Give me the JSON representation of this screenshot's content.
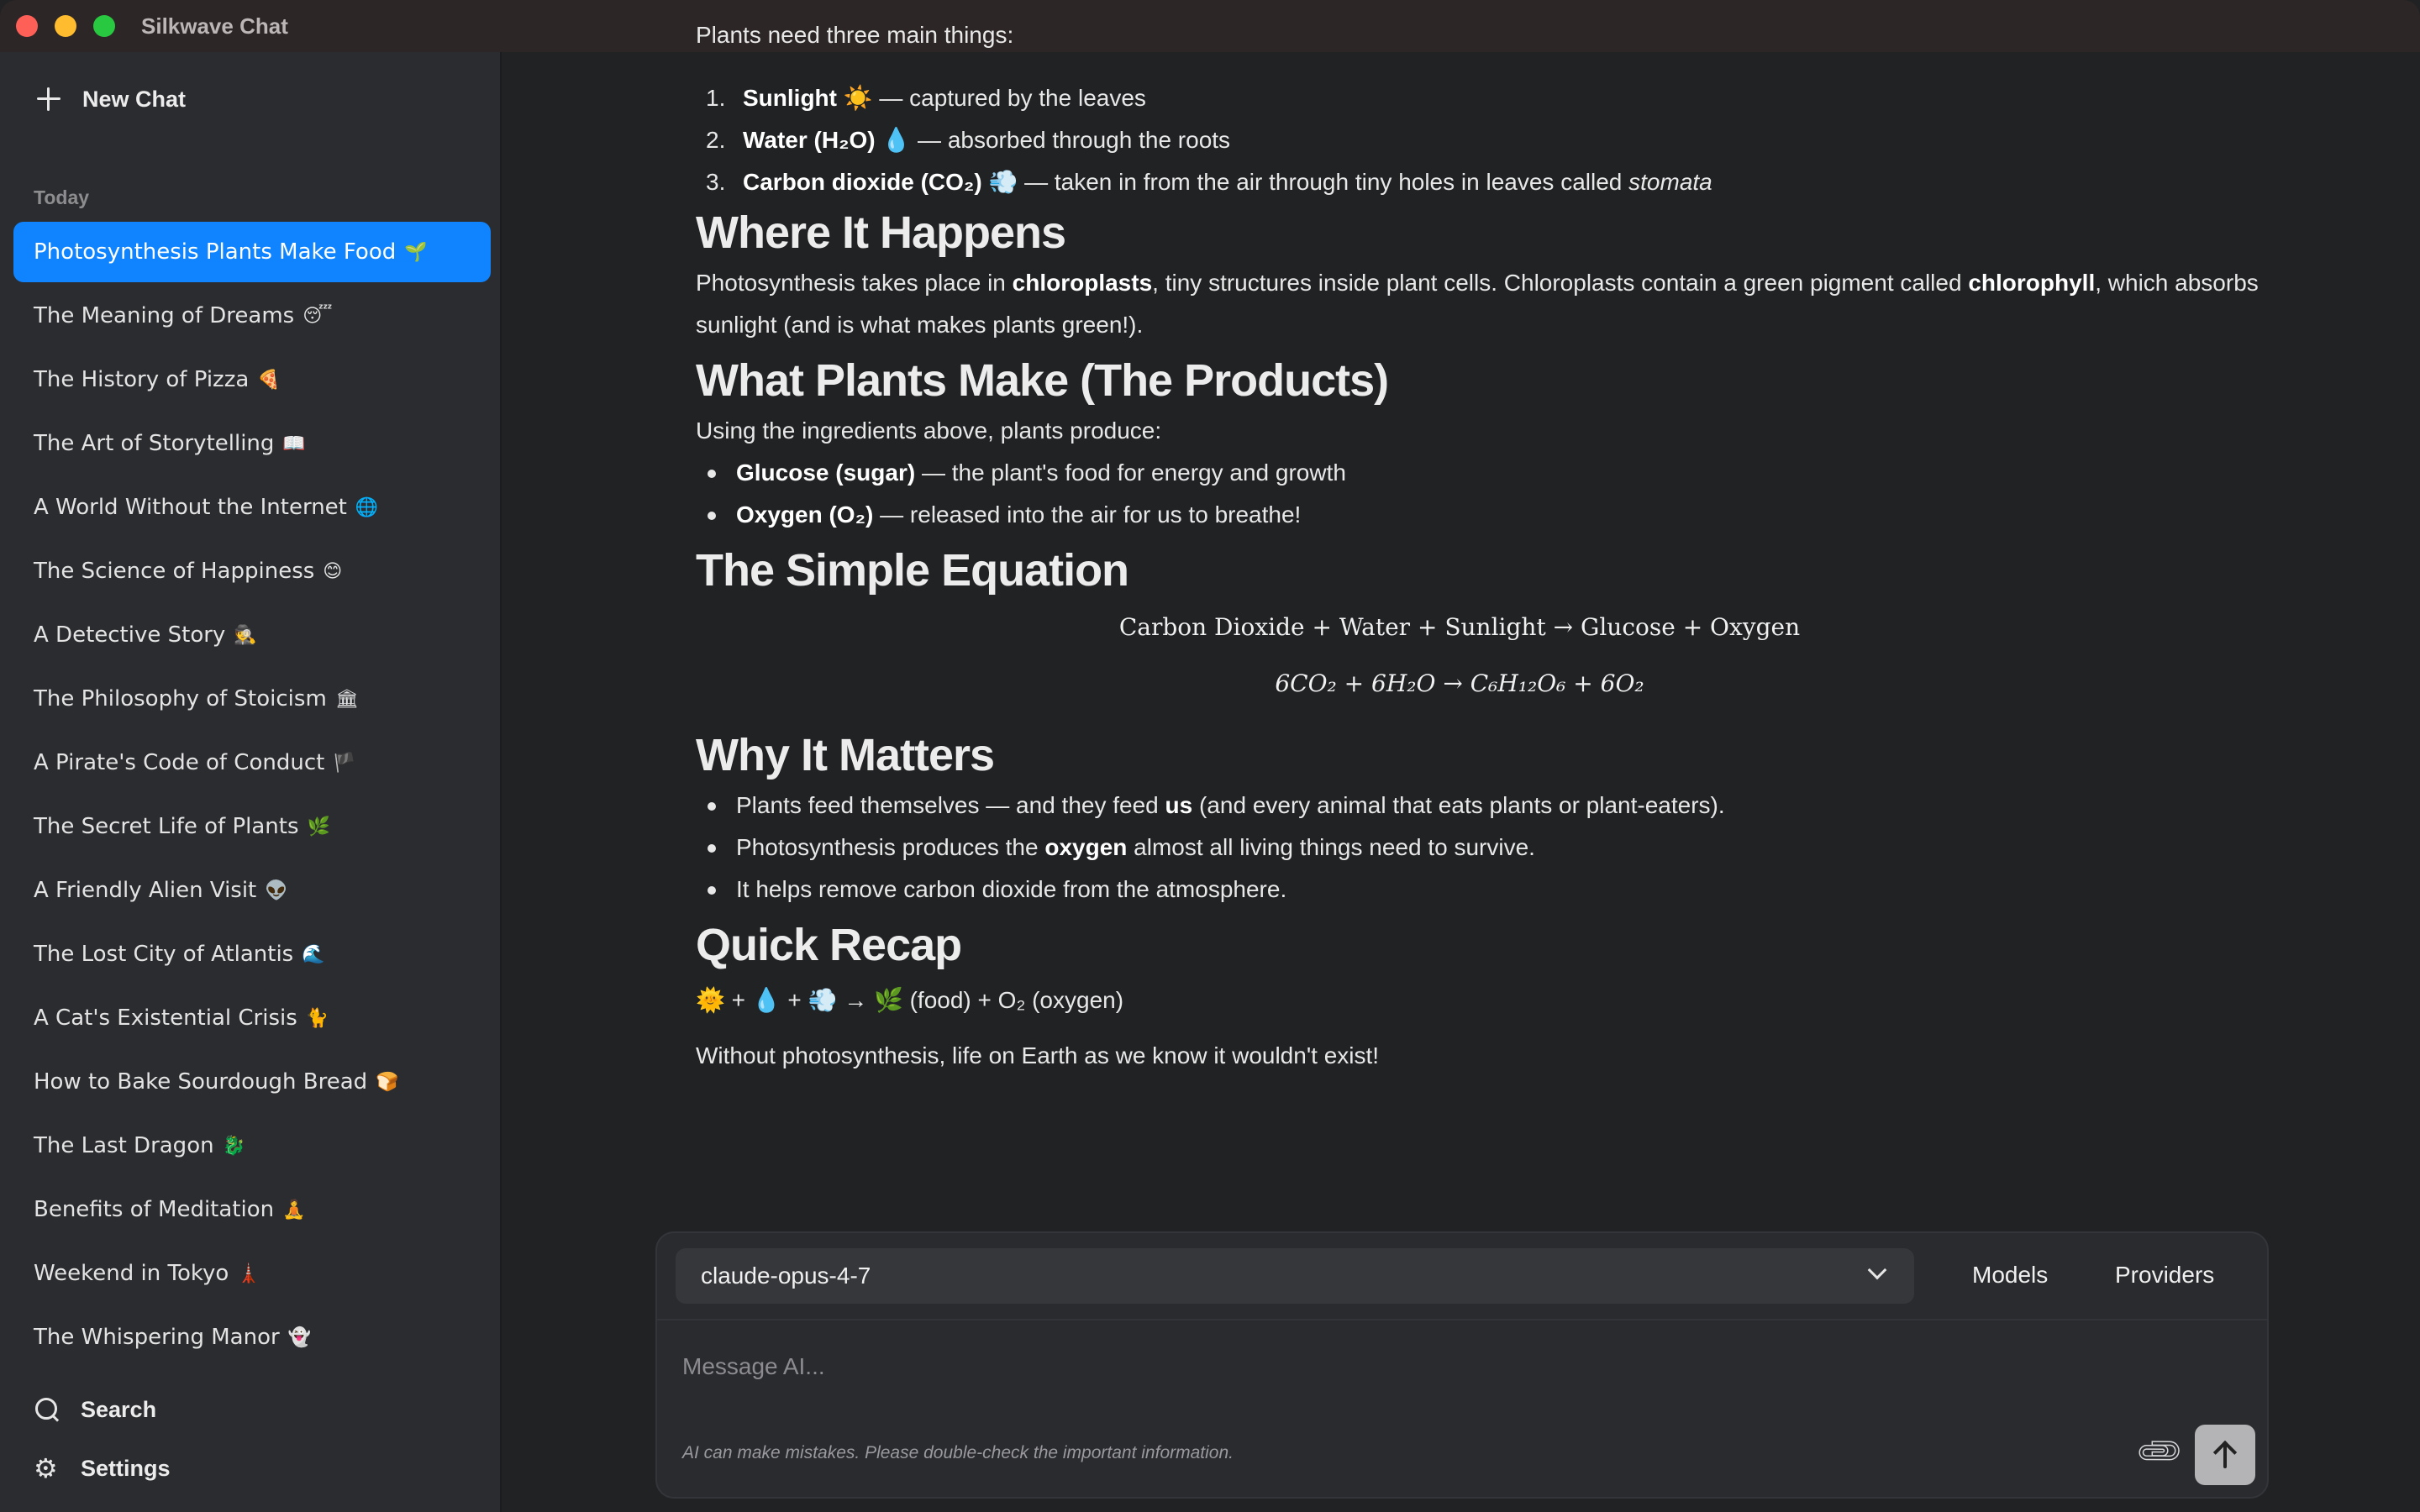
{
  "window": {
    "title": "Silkwave Chat"
  },
  "sidebar": {
    "new_chat_label": "New Chat",
    "section_label": "Today",
    "items": [
      {
        "label": "Photosynthesis Plants Make Food",
        "emoji": "🌱",
        "active": true
      },
      {
        "label": "The Meaning of Dreams",
        "emoji": "😴"
      },
      {
        "label": "The History of Pizza",
        "emoji": "🍕"
      },
      {
        "label": "The Art of Storytelling",
        "emoji": "📖"
      },
      {
        "label": "A World Without the Internet",
        "emoji": "🌐"
      },
      {
        "label": "The Science of Happiness",
        "emoji": "😊"
      },
      {
        "label": "A Detective Story",
        "emoji": "🕵"
      },
      {
        "label": "The Philosophy of Stoicism",
        "emoji": "🏛"
      },
      {
        "label": "A Pirate's Code of Conduct",
        "emoji": "🏴"
      },
      {
        "label": "The Secret Life of Plants",
        "emoji": "🌿"
      },
      {
        "label": "A Friendly Alien Visit",
        "emoji": "👽"
      },
      {
        "label": "The Lost City of Atlantis",
        "emoji": "🌊"
      },
      {
        "label": "A Cat's Existential Crisis",
        "emoji": "🐈"
      },
      {
        "label": "How to Bake Sourdough Bread",
        "emoji": "🍞"
      },
      {
        "label": "The Last Dragon",
        "emoji": "🐉"
      },
      {
        "label": "Benefits of Meditation",
        "emoji": "🧘"
      },
      {
        "label": "Weekend in Tokyo",
        "emoji": "🗼"
      },
      {
        "label": "The Whispering Manor",
        "emoji": "👻"
      }
    ],
    "search_label": "Search",
    "settings_label": "Settings"
  },
  "message": {
    "cut_intro": "Plants need three main things:",
    "ingredients": [
      {
        "num": "1.",
        "bold": "Sunlight ☀️",
        "rest": " — captured by the leaves"
      },
      {
        "num": "2.",
        "bold": "Water (H₂O) 💧",
        "rest": " — absorbed through the roots"
      },
      {
        "num": "3.",
        "bold": "Carbon dioxide (CO₂) 💨",
        "rest": " — taken in from the air through tiny holes in leaves called ",
        "italic": "stomata"
      }
    ],
    "h_where": "Where It Happens",
    "where_p": {
      "a": "Photosynthesis takes place in ",
      "b": "chloroplasts",
      "c": ", tiny structures inside plant cells. Chloroplasts contain a green pigment called ",
      "d": "chlorophyll",
      "e": ", which absorbs sunlight (and is what makes plants green!)."
    },
    "h_products": "What Plants Make (The Products)",
    "products_intro": "Using the ingredients above, plants produce:",
    "products": [
      {
        "bold": "Glucose (sugar)",
        "rest": " — the plant's food for energy and growth"
      },
      {
        "bold": "Oxygen (O₂)",
        "rest": " — released into the air for us to breathe!"
      }
    ],
    "h_equation": "The Simple Equation",
    "equation_words": "Carbon Dioxide + Water + Sunlight → Glucose + Oxygen",
    "equation_formula": "6CO₂ + 6H₂O → C₆H₁₂O₆ + 6O₂",
    "h_matters": "Why It Matters",
    "matters": [
      {
        "a": "Plants feed themselves — and they feed ",
        "b": "us",
        "c": " (and every animal that eats plants or plant-eaters)."
      },
      {
        "a": "Photosynthesis produces the ",
        "b": "oxygen",
        "c": " almost all living things need to survive."
      },
      {
        "a": "It helps remove carbon dioxide from the atmosphere.",
        "b": "",
        "c": ""
      }
    ],
    "h_recap": "Quick Recap",
    "recap_line": "🌞 + 💧 + 💨 → 🌿 (food) + O₂ (oxygen)",
    "closing": "Without photosynthesis, life on Earth as we know it wouldn't exist!"
  },
  "composer": {
    "model": "claude-opus-4-7",
    "models_label": "Models",
    "providers_label": "Providers",
    "placeholder": "Message AI...",
    "disclaimer": "AI can make mistakes. Please double-check the important information."
  },
  "colors": {
    "accent": "#0f84fe",
    "background": "#212224",
    "sidebar": "#2b2c2f"
  }
}
